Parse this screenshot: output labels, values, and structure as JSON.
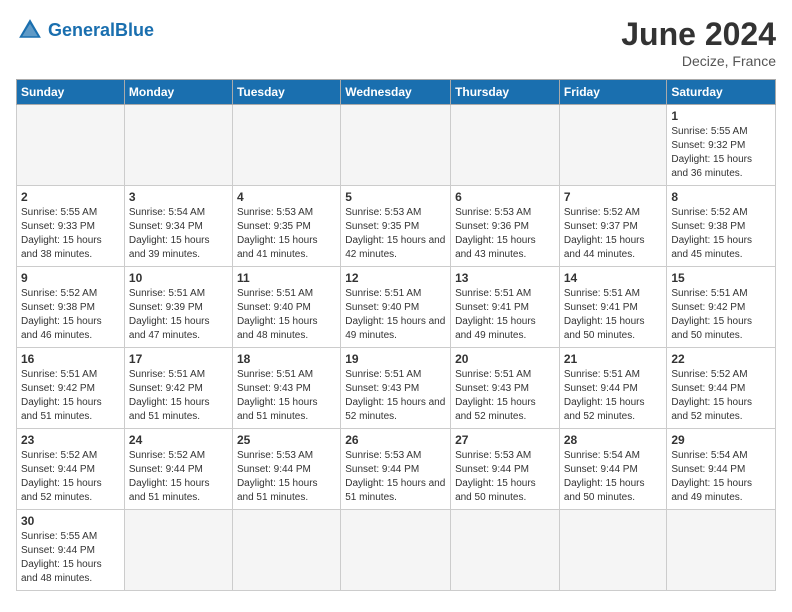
{
  "header": {
    "logo_general": "General",
    "logo_blue": "Blue",
    "month_title": "June 2024",
    "location": "Decize, France"
  },
  "weekdays": [
    "Sunday",
    "Monday",
    "Tuesday",
    "Wednesday",
    "Thursday",
    "Friday",
    "Saturday"
  ],
  "days": {
    "1": {
      "sunrise": "5:55 AM",
      "sunset": "9:32 PM",
      "daylight": "15 hours and 36 minutes."
    },
    "2": {
      "sunrise": "5:55 AM",
      "sunset": "9:33 PM",
      "daylight": "15 hours and 38 minutes."
    },
    "3": {
      "sunrise": "5:54 AM",
      "sunset": "9:34 PM",
      "daylight": "15 hours and 39 minutes."
    },
    "4": {
      "sunrise": "5:53 AM",
      "sunset": "9:35 PM",
      "daylight": "15 hours and 41 minutes."
    },
    "5": {
      "sunrise": "5:53 AM",
      "sunset": "9:35 PM",
      "daylight": "15 hours and 42 minutes."
    },
    "6": {
      "sunrise": "5:53 AM",
      "sunset": "9:36 PM",
      "daylight": "15 hours and 43 minutes."
    },
    "7": {
      "sunrise": "5:52 AM",
      "sunset": "9:37 PM",
      "daylight": "15 hours and 44 minutes."
    },
    "8": {
      "sunrise": "5:52 AM",
      "sunset": "9:38 PM",
      "daylight": "15 hours and 45 minutes."
    },
    "9": {
      "sunrise": "5:52 AM",
      "sunset": "9:38 PM",
      "daylight": "15 hours and 46 minutes."
    },
    "10": {
      "sunrise": "5:51 AM",
      "sunset": "9:39 PM",
      "daylight": "15 hours and 47 minutes."
    },
    "11": {
      "sunrise": "5:51 AM",
      "sunset": "9:40 PM",
      "daylight": "15 hours and 48 minutes."
    },
    "12": {
      "sunrise": "5:51 AM",
      "sunset": "9:40 PM",
      "daylight": "15 hours and 49 minutes."
    },
    "13": {
      "sunrise": "5:51 AM",
      "sunset": "9:41 PM",
      "daylight": "15 hours and 49 minutes."
    },
    "14": {
      "sunrise": "5:51 AM",
      "sunset": "9:41 PM",
      "daylight": "15 hours and 50 minutes."
    },
    "15": {
      "sunrise": "5:51 AM",
      "sunset": "9:42 PM",
      "daylight": "15 hours and 50 minutes."
    },
    "16": {
      "sunrise": "5:51 AM",
      "sunset": "9:42 PM",
      "daylight": "15 hours and 51 minutes."
    },
    "17": {
      "sunrise": "5:51 AM",
      "sunset": "9:42 PM",
      "daylight": "15 hours and 51 minutes."
    },
    "18": {
      "sunrise": "5:51 AM",
      "sunset": "9:43 PM",
      "daylight": "15 hours and 51 minutes."
    },
    "19": {
      "sunrise": "5:51 AM",
      "sunset": "9:43 PM",
      "daylight": "15 hours and 52 minutes."
    },
    "20": {
      "sunrise": "5:51 AM",
      "sunset": "9:43 PM",
      "daylight": "15 hours and 52 minutes."
    },
    "21": {
      "sunrise": "5:51 AM",
      "sunset": "9:44 PM",
      "daylight": "15 hours and 52 minutes."
    },
    "22": {
      "sunrise": "5:52 AM",
      "sunset": "9:44 PM",
      "daylight": "15 hours and 52 minutes."
    },
    "23": {
      "sunrise": "5:52 AM",
      "sunset": "9:44 PM",
      "daylight": "15 hours and 52 minutes."
    },
    "24": {
      "sunrise": "5:52 AM",
      "sunset": "9:44 PM",
      "daylight": "15 hours and 51 minutes."
    },
    "25": {
      "sunrise": "5:53 AM",
      "sunset": "9:44 PM",
      "daylight": "15 hours and 51 minutes."
    },
    "26": {
      "sunrise": "5:53 AM",
      "sunset": "9:44 PM",
      "daylight": "15 hours and 51 minutes."
    },
    "27": {
      "sunrise": "5:53 AM",
      "sunset": "9:44 PM",
      "daylight": "15 hours and 50 minutes."
    },
    "28": {
      "sunrise": "5:54 AM",
      "sunset": "9:44 PM",
      "daylight": "15 hours and 50 minutes."
    },
    "29": {
      "sunrise": "5:54 AM",
      "sunset": "9:44 PM",
      "daylight": "15 hours and 49 minutes."
    },
    "30": {
      "sunrise": "5:55 AM",
      "sunset": "9:44 PM",
      "daylight": "15 hours and 48 minutes."
    }
  },
  "labels": {
    "sunrise": "Sunrise:",
    "sunset": "Sunset:",
    "daylight": "Daylight:"
  }
}
